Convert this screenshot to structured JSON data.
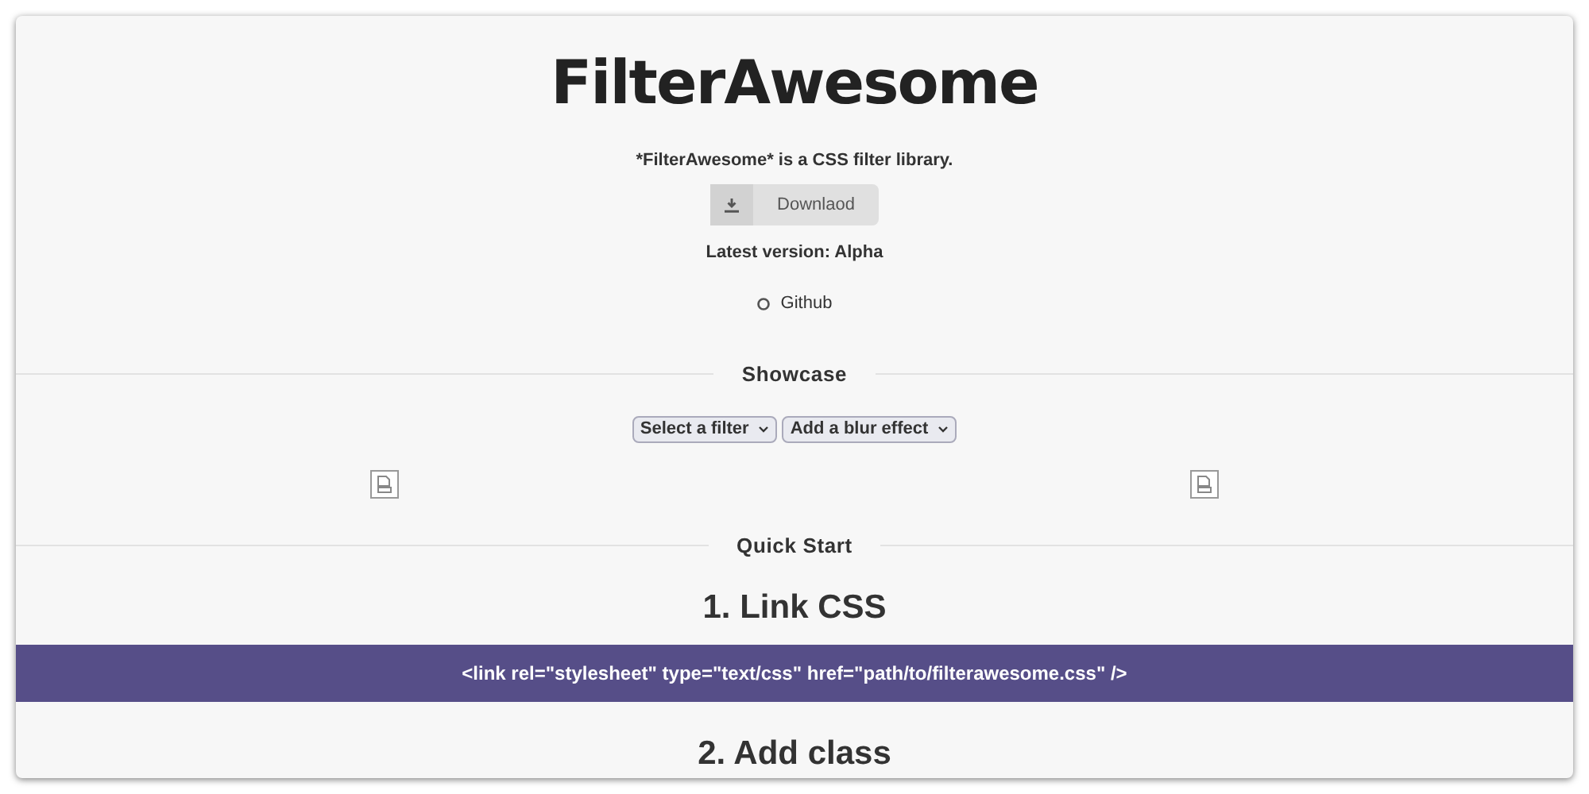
{
  "header": {
    "title": "FilterAwesome",
    "tagline": "*FilterAwesome* is a CSS filter library.",
    "download_button": "Downlaod",
    "version": "Latest version: Alpha",
    "github_link": "Github"
  },
  "showcase": {
    "heading": "Showcase",
    "selects": [
      {
        "value": "Select a filter"
      },
      {
        "value": "Add a blur effect"
      }
    ],
    "images": [
      {
        "kind": "broken-image"
      },
      {
        "kind": "broken-image"
      }
    ]
  },
  "quick_start": {
    "heading": "Quick Start",
    "steps": [
      {
        "title": "1. Link CSS",
        "code": "<link rel=\"stylesheet\" type=\"text/css\" href=\"path/to/filterawesome.css\" />"
      },
      {
        "title": "2. Add class"
      }
    ]
  }
}
